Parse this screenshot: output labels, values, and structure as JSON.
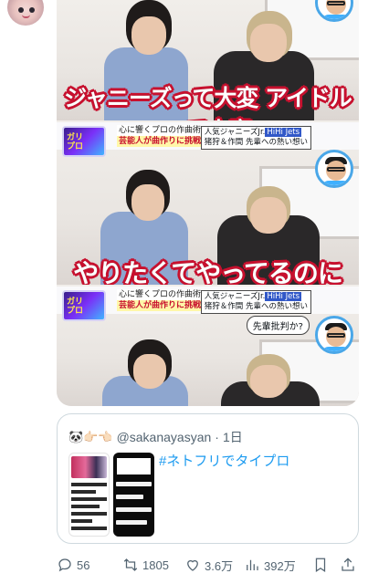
{
  "media": {
    "caption_1": "ジャニーズって大変 アイドルって大変",
    "caption_2": "やりたくてやってるのに",
    "bar_line_1": "心に響くプロの作曲術で",
    "bar_line_2": "芸能人が曲作りに挑戦!!",
    "logo_text": "ガリ\nプロ",
    "info_line_1_prefix": "人気ジャニーズJr.",
    "info_line_1_group": "HiHi Jets",
    "info_line_2": "猪狩＆作間 先輩への熱い想い",
    "bubble": "先輩批判か?"
  },
  "quote": {
    "emoji": "🐼👉🏻👈🏻",
    "user": "@sakanayasyan",
    "separator": "·",
    "time": "1日",
    "text": "#ネトフリでタイプロ"
  },
  "actions": {
    "replies": "56",
    "retweets": "1805",
    "likes": "3.6万",
    "views": "392万"
  },
  "icons": [
    "avatar",
    "reply-icon",
    "retweet-icon",
    "like-icon",
    "views-icon",
    "bookmark-icon",
    "share-icon"
  ]
}
